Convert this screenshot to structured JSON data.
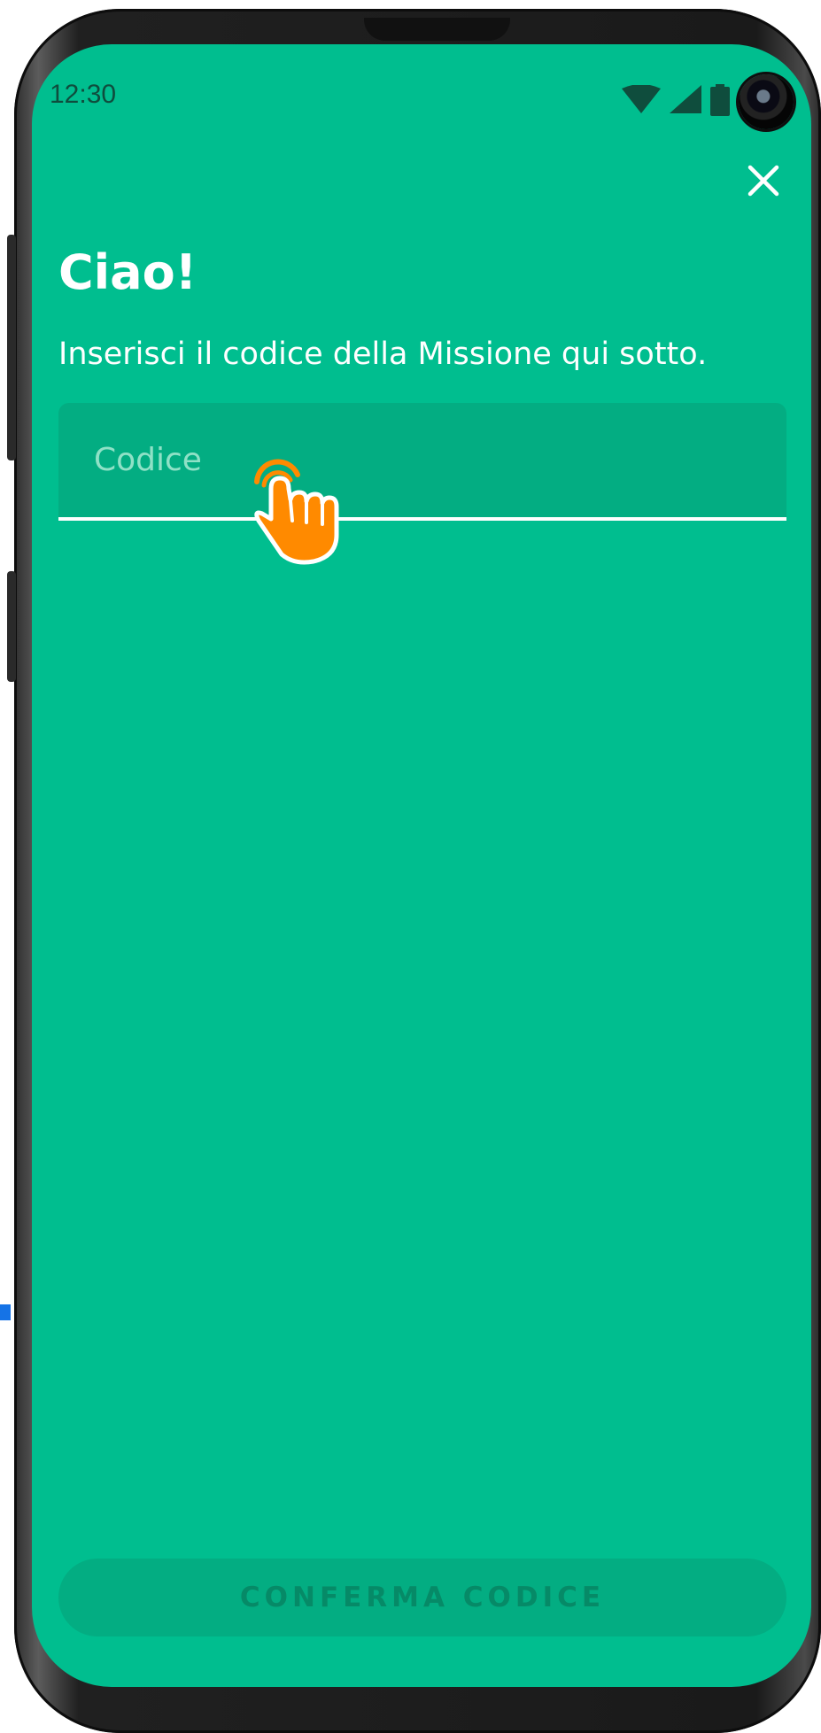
{
  "status_bar": {
    "time": "12:30",
    "icons": [
      "wifi-icon",
      "cellular-signal-icon",
      "battery-icon",
      "front-camera"
    ]
  },
  "header": {
    "close_icon": "close-icon"
  },
  "main": {
    "title": "Ciao!",
    "subtitle": "Inserisci il codice della Missione qui sotto.",
    "code_input": {
      "placeholder": "Codice",
      "value": ""
    },
    "confirm_label": "CONFERMA CODICE"
  },
  "overlay": {
    "pointer_icon": "tap-hand-icon"
  },
  "colors": {
    "background": "#00be8f",
    "input_background": "#03ad82",
    "button_background": "#03ad82",
    "button_text": "#068a67",
    "placeholder": "#8fe1c6",
    "status_text": "#0f4d3d",
    "hand": "#ff8a00"
  }
}
